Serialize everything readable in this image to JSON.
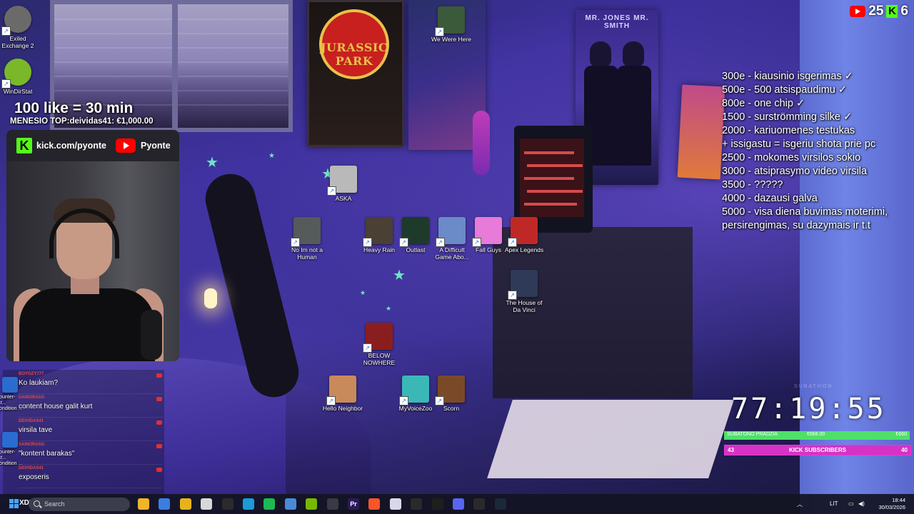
{
  "desktop_icons": [
    {
      "id": "exiled",
      "label": "Exiled Exchange 2",
      "color": "#6a6a6a"
    },
    {
      "id": "windirstat",
      "label": "WinDirStat",
      "color": "#7ab82a"
    },
    {
      "id": "wewerehere",
      "label": "We Were Here",
      "color": "#3a5a3a"
    },
    {
      "id": "aska",
      "label": "ASKA",
      "color": "#b9b9b9"
    },
    {
      "id": "noimnotahuman",
      "label": "No Im not a Human",
      "color": "#555a5a"
    },
    {
      "id": "heavyrain",
      "label": "Heavy Rain",
      "color": "#4a4034"
    },
    {
      "id": "outlast",
      "label": "Outlast",
      "color": "#1e3a2a"
    },
    {
      "id": "difficultgame",
      "label": "A Difficult Game Abo...",
      "color": "#6a8ac8"
    },
    {
      "id": "fallguys",
      "label": "Fall Guys",
      "color": "#e87ad8"
    },
    {
      "id": "apex",
      "label": "Apex Legends",
      "color": "#c02828"
    },
    {
      "id": "houseofdavinci",
      "label": "The House of Da Vinci",
      "color": "#2e3a58"
    },
    {
      "id": "belownowhere",
      "label": "BELOW NOWHERE",
      "color": "#8a1e1e"
    },
    {
      "id": "helloneighbor",
      "label": "Hello Neighbor",
      "color": "#c88a5a"
    },
    {
      "id": "myvoicezoo",
      "label": "MyVoiceZoo",
      "color": "#3ab8b8"
    },
    {
      "id": "scorn",
      "label": "Scorn",
      "color": "#7a4a28"
    }
  ],
  "wallpaper": {
    "poster_jurassic": "JURASSIC PARK",
    "poster_mib": "MR. JONES  MR. SMITH"
  },
  "overlay": {
    "like_banner": "100 like = 30 min",
    "top_donor": "MENESIO TOP:deividas41: €1,000.00",
    "kick_url": "kick.com/pyonte",
    "youtube_name": "Pyonte",
    "yt_count": "25",
    "kick_count": "6",
    "goals": [
      "300e - kiausinio isgerimas ✓",
      "500e - 500 atsispaudimu ✓",
      "800e - one chip ✓",
      "1500 - surströmming silke ✓",
      "2000 - kariuomenes testukas",
      "+ issigastu = isgeriu shota prie pc",
      "2500 - mokomes virsilos sokio",
      "3000 - atsiprasymo video virsila",
      "3500 - ?????",
      "4000 - dazausi galva",
      "5000 - visa diena buvimas moterimi,",
      "persirengimas, su dazymais ir t.t"
    ],
    "timer_caption": "SUBATHON",
    "timer": "77:19:55",
    "subathon_bar": {
      "left": "SUBATONO PRADZIA",
      "mid": "€668.00",
      "right": "€660",
      "progress": 1.0
    },
    "kick_bar": {
      "current": "43",
      "label": "KICK SUBSCRIBERS",
      "goal": "40",
      "progress": 1.0
    }
  },
  "chat": [
    {
      "user": "BOYGZY777",
      "text": "Ko laukiam?"
    },
    {
      "user": "SAINORASG",
      "text": "content house galit kurt"
    },
    {
      "user": "DEIVIDAS41",
      "text": "virsila tave"
    },
    {
      "user": "SAINORASG",
      "text": "\"kontent barakas\""
    },
    {
      "user": "DEIVIDAS41",
      "text": "exposeris"
    }
  ],
  "side_icons": [
    {
      "label": "Counter-Str... Condition ..."
    },
    {
      "label": "Counter-Str... Condition ..."
    }
  ],
  "taskbar": {
    "start_text": "XDD",
    "search_placeholder": "Search",
    "apps": [
      {
        "name": "file-explorer-icon",
        "color": "#f0b429",
        "glyph": ""
      },
      {
        "name": "store-icon",
        "color": "#3b7de0",
        "glyph": ""
      },
      {
        "name": "chrome-icon",
        "color": "#e8b31a",
        "glyph": ""
      },
      {
        "name": "notepad-icon",
        "color": "#d8d8d8",
        "glyph": ""
      },
      {
        "name": "inkscape-icon",
        "color": "#2b2b2b",
        "glyph": ""
      },
      {
        "name": "edge-icon",
        "color": "#1a9ad8",
        "glyph": ""
      },
      {
        "name": "spotify-icon",
        "color": "#1db954",
        "glyph": ""
      },
      {
        "name": "photos-icon",
        "color": "#4a8ad8",
        "glyph": ""
      },
      {
        "name": "nvidia-icon",
        "color": "#76b900",
        "glyph": ""
      },
      {
        "name": "obs-icon",
        "color": "#3a3a44",
        "glyph": ""
      },
      {
        "name": "premiere-icon",
        "color": "#2a1a5a",
        "glyph": "Pr"
      },
      {
        "name": "brave-icon",
        "color": "#fb542b",
        "glyph": ""
      },
      {
        "name": "notes-icon",
        "color": "#d8d8e8",
        "glyph": ""
      },
      {
        "name": "capcut-icon",
        "color": "#2a2a2a",
        "glyph": ""
      },
      {
        "name": "terminal-icon",
        "color": "#1e1e1e",
        "glyph": ""
      },
      {
        "name": "discord-icon",
        "color": "#5865f2",
        "glyph": ""
      },
      {
        "name": "chatgpt-icon",
        "color": "#2a2a2a",
        "glyph": ""
      },
      {
        "name": "steam-icon",
        "color": "#1b2838",
        "glyph": ""
      }
    ],
    "lang": "LIT",
    "time": "18:44",
    "date": "30/03/2026"
  }
}
